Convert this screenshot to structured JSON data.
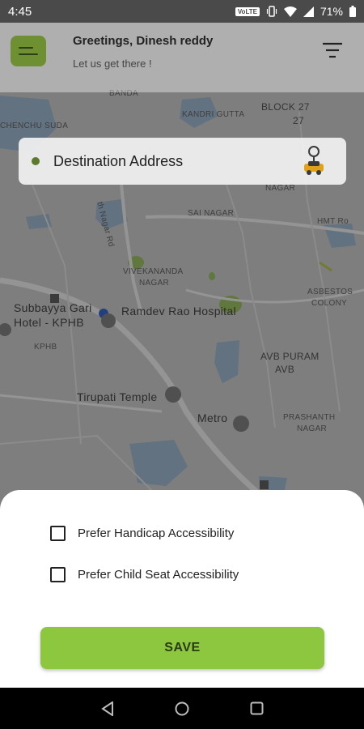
{
  "status_bar": {
    "time": "4:45",
    "network": "VoLTE",
    "battery": "71%"
  },
  "header": {
    "greeting": "Greetings, Dinesh reddy",
    "subtitle": "Let us get there !"
  },
  "destination": {
    "placeholder": "Destination Address"
  },
  "map": {
    "labels": {
      "chenchu": "CHENCHU SUDA",
      "banda": "BANDA",
      "kandri": "KANDRI GUTTA",
      "block27": "BLOCK 27",
      "n27": "27",
      "nagar1": "NAGAR",
      "sai_nagar": "SAI NAGAR",
      "hmt": "HMT Ro",
      "road": "th Nagar Rd",
      "vivekananda": "VIVEKANANDA",
      "nagar2": "NAGAR",
      "subbayya": "Subbayya Gari",
      "hotel": "Hotel - KPHB",
      "ramdev": "Ramdev Rao Hospital",
      "kphb": "KPHB",
      "asbestos": "ASBESTOS",
      "colony": "COLONY",
      "avb_puram": "AVB PURAM",
      "avb": "AVB",
      "tirupati": "Tirupati Temple",
      "metro": "Metro",
      "prashanth": "PRASHANTH",
      "nagar3": "NAGAR"
    }
  },
  "preferences": {
    "handicap": "Prefer Handicap Accessibility",
    "child_seat": "Prefer Child Seat Accessibility",
    "save": "SAVE"
  },
  "colors": {
    "accent": "#8dc63f",
    "menu": "#6f8f33"
  }
}
